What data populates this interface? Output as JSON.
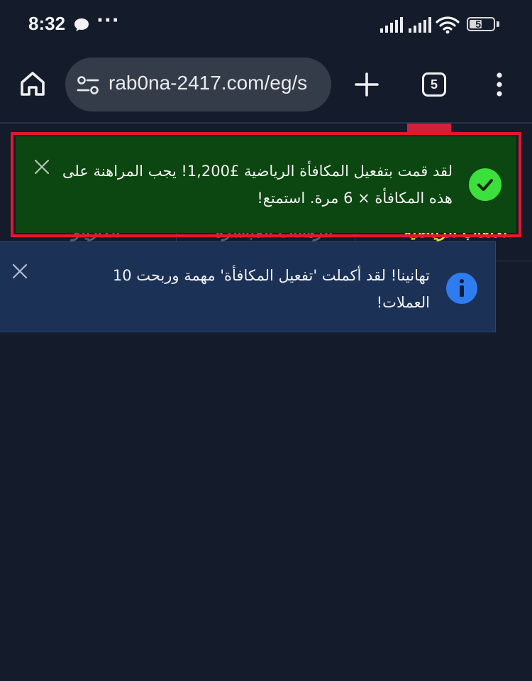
{
  "status_bar": {
    "time": "8:32",
    "more_indicator": "···",
    "battery_level": "53",
    "battery_fraction": 0.53
  },
  "browser": {
    "url": "rab0na-2417.com/eg/s",
    "tab_count": "5"
  },
  "page_tabs": [
    {
      "label": "الألعاب الرياضية",
      "active": true
    },
    {
      "label": "الرهانات المباشرة",
      "active": false
    },
    {
      "label": "الكازينو",
      "active": false
    }
  ],
  "notifications": {
    "success": {
      "text": "لقد قمت بتفعيل المكافأة الرياضية £1,200! يجب المراهنة على هذه المكافأة × 6 مرة. استمتع!",
      "color": "#0c4610"
    },
    "info": {
      "text": "تهانينا! لقد أكملت 'تفعيل المكافأة' مهمة وربحت 10 العملات!",
      "color": "#1c3156"
    }
  },
  "colors": {
    "page_background": "#141c2c",
    "url_bar": "#343c4a",
    "highlight_outline": "#e0192c",
    "success_icon": "#3ce03c",
    "info_icon": "#2f7cf0",
    "active_tab": "#e0e02a"
  }
}
